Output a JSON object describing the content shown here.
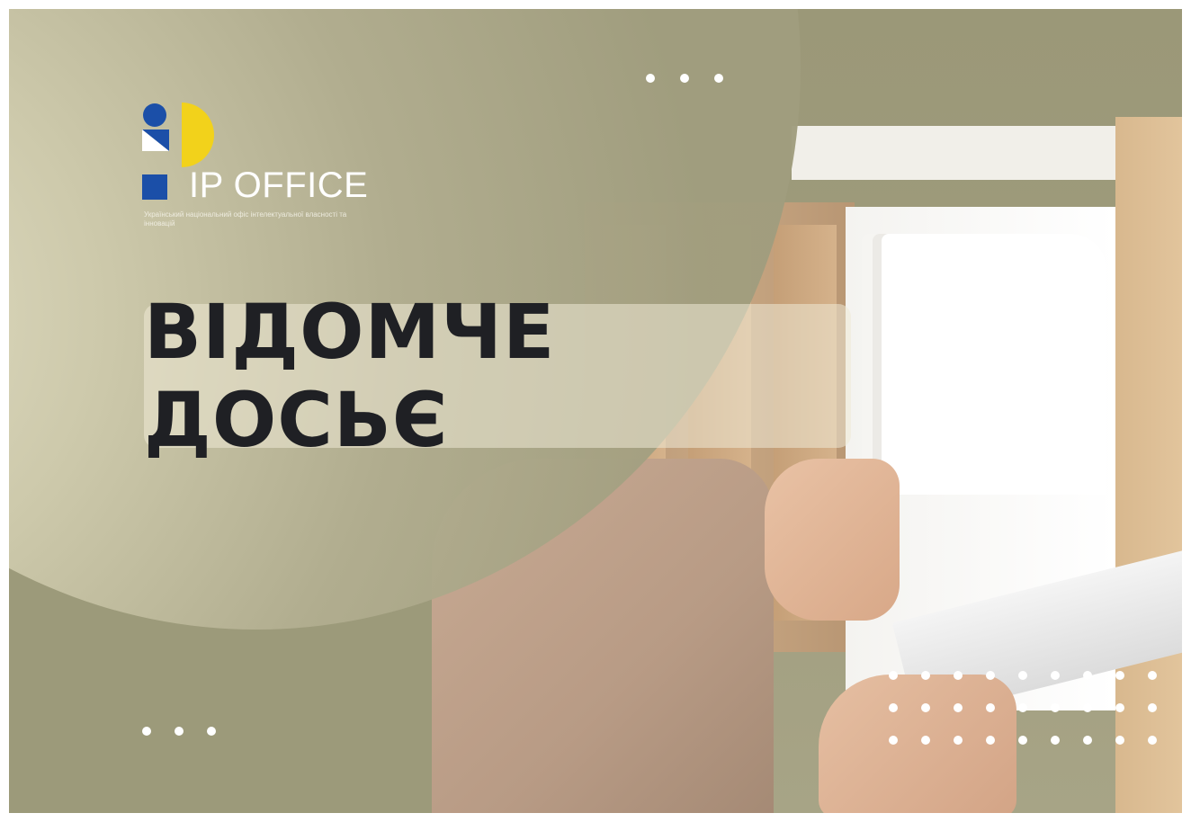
{
  "banner": {
    "title": "ВІДОМЧЕ ДОСЬЄ",
    "logo": {
      "name": "IP OFFICE",
      "subtitle": "Український національний офіс інтелектуальної власності та інновацій"
    },
    "colors": {
      "background": "#9c9a7a",
      "circle": "#d8d4b6",
      "title_text": "#1f2024",
      "logo_blue": "#1b4fa8",
      "logo_yellow": "#f2d21b",
      "dots": "#ffffff"
    },
    "decorations": [
      "dots-top-icon",
      "dots-bottom-left-icon",
      "dot-grid-icon"
    ]
  }
}
